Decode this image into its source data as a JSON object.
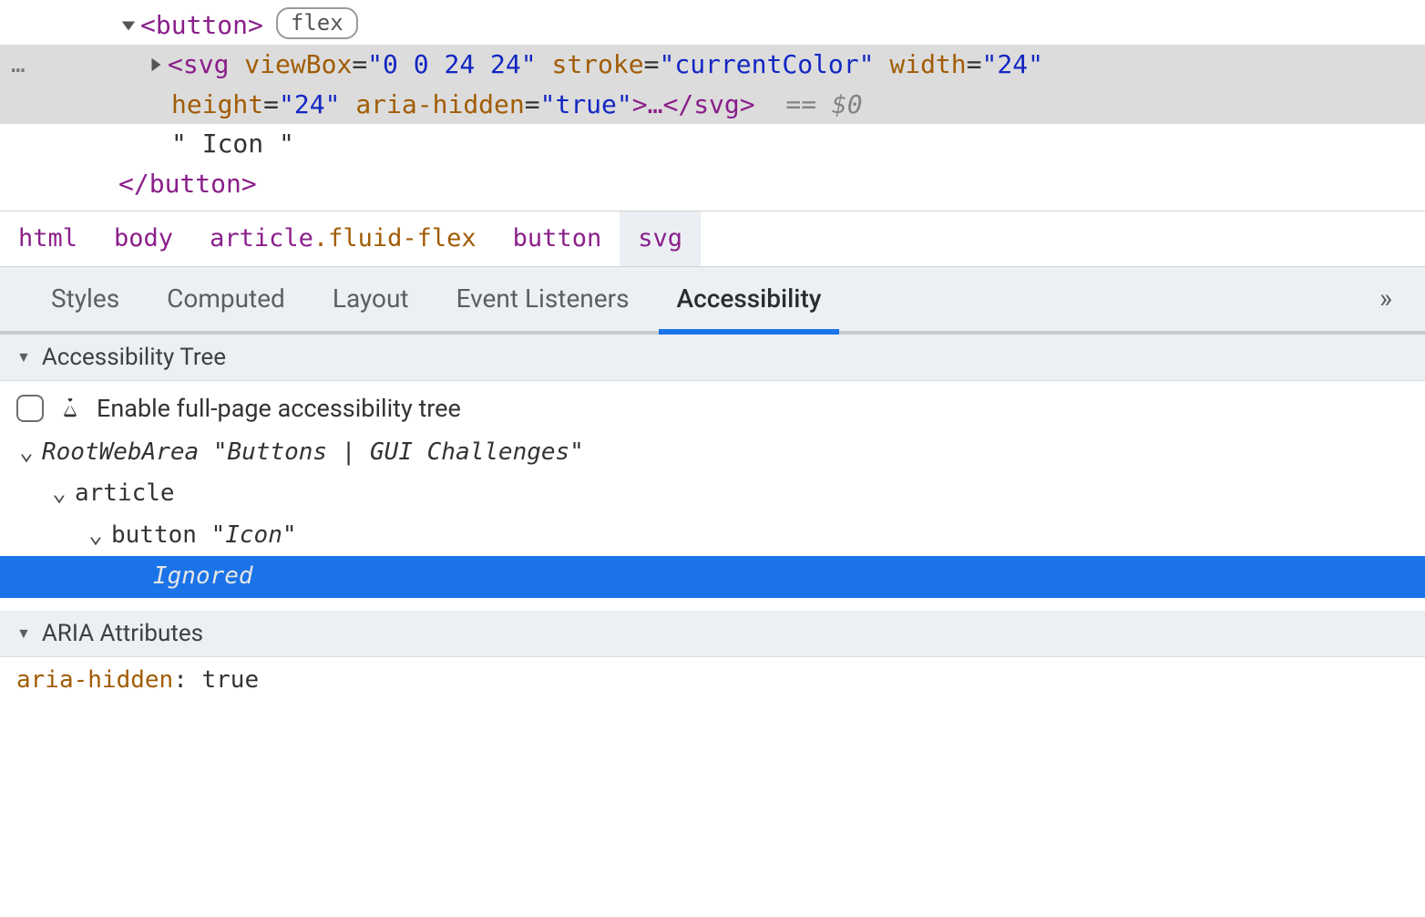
{
  "dom": {
    "button_open": "<button>",
    "flex_badge": "flex",
    "svg_open_lead": "<svg",
    "svg_attrs": [
      {
        "name": "viewBox",
        "value": "\"0 0 24 24\""
      },
      {
        "name": "stroke",
        "value": "\"currentColor\""
      },
      {
        "name": "width",
        "value": "\"24\""
      },
      {
        "name": "height",
        "value": "\"24\""
      },
      {
        "name": "aria-hidden",
        "value": "\"true\""
      }
    ],
    "svg_close": "…</svg>",
    "selection_ref": "== $0",
    "text_node": "\" Icon \"",
    "button_close": "</button>",
    "gutter": "…"
  },
  "breadcrumbs": [
    {
      "label": "html",
      "selected": false
    },
    {
      "label": "body",
      "selected": false
    },
    {
      "label": "article.fluid-flex",
      "selected": false
    },
    {
      "label": "button",
      "selected": false
    },
    {
      "label": "svg",
      "selected": true
    }
  ],
  "sub_tabs": {
    "items": [
      "Styles",
      "Computed",
      "Layout",
      "Event Listeners",
      "Accessibility"
    ],
    "active": "Accessibility",
    "more_glyph": "»"
  },
  "a11y": {
    "tree_header": "Accessibility Tree",
    "enable_label": "Enable full-page accessibility tree",
    "tree": [
      {
        "depth": 0,
        "twisty": "down",
        "role": "RootWebArea",
        "name": "\"Buttons | GUI Challenges\""
      },
      {
        "depth": 1,
        "twisty": "down",
        "role": "article",
        "name": ""
      },
      {
        "depth": 2,
        "twisty": "down",
        "role": "button",
        "name": "\"Icon\""
      },
      {
        "depth": 3,
        "twisty": "",
        "role": "Ignored",
        "name": "",
        "selected": true
      }
    ],
    "aria_header": "ARIA Attributes",
    "aria_attr_name": "aria-hidden",
    "aria_attr_value": ": true"
  }
}
